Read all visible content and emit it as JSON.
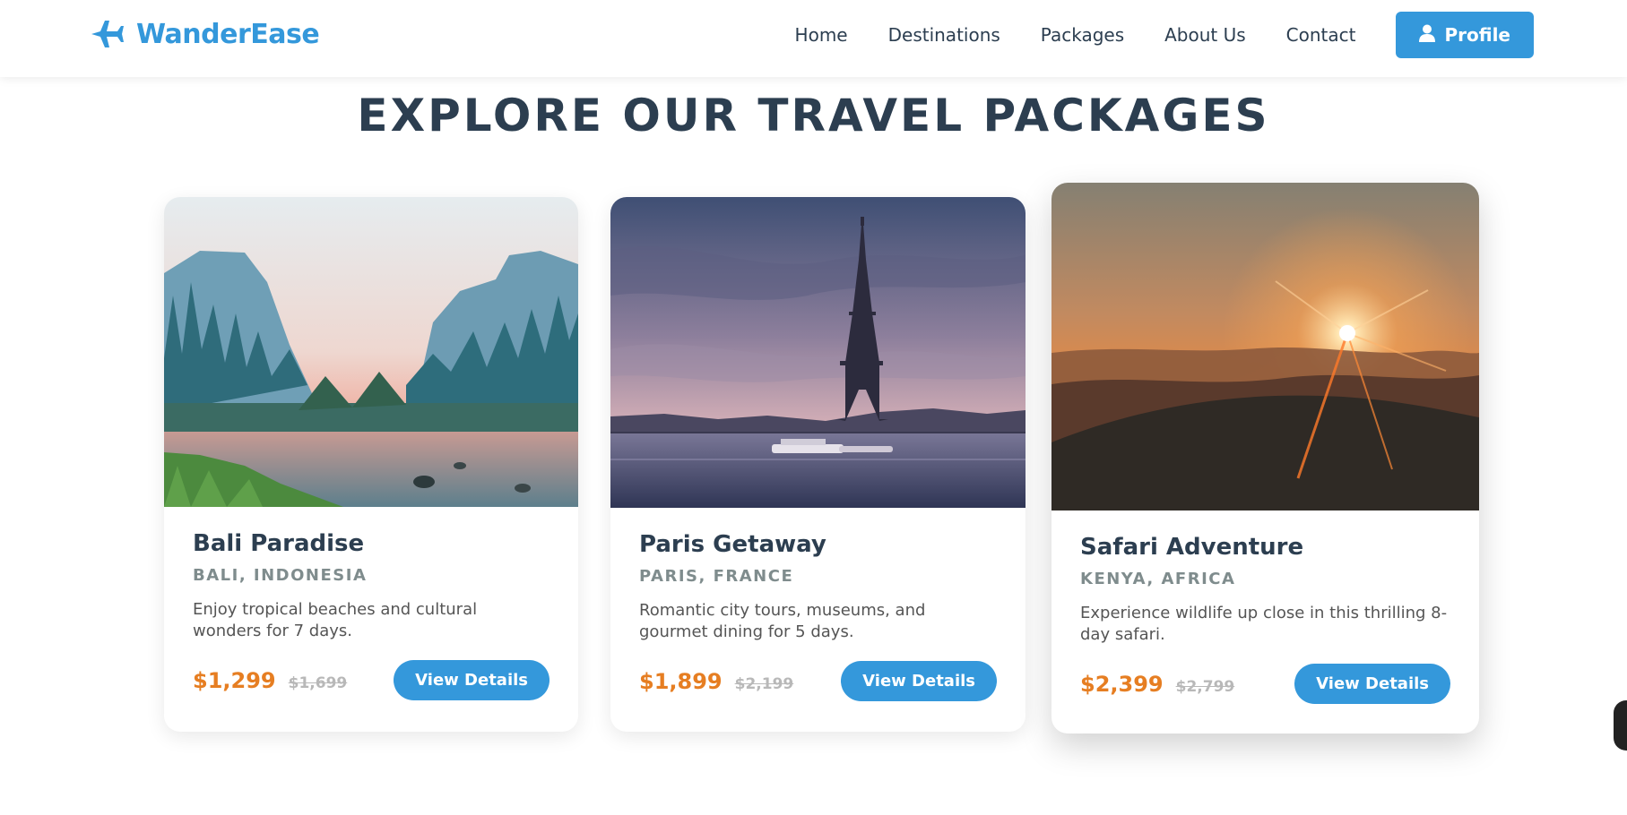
{
  "brand": {
    "name": "WanderEase",
    "icon": "airplane-icon",
    "color": "#3498db"
  },
  "nav": {
    "links": [
      "Home",
      "Destinations",
      "Packages",
      "About Us",
      "Contact"
    ],
    "profile_label": "Profile",
    "profile_icon": "user-icon"
  },
  "page": {
    "title": "EXPLORE OUR TRAVEL PACKAGES"
  },
  "packages": [
    {
      "title": "Bali Paradise",
      "location": "BALI, INDONESIA",
      "description": "Enjoy tropical beaches and cultural wonders for 7 days.",
      "price": "$1,299",
      "old_price": "$1,699",
      "button": "View Details"
    },
    {
      "title": "Paris Getaway",
      "location": "PARIS, FRANCE",
      "description": "Romantic city tours, museums, and gourmet dining for 5 days.",
      "price": "$1,899",
      "old_price": "$2,199",
      "button": "View Details"
    },
    {
      "title": "Safari Adventure",
      "location": "KENYA, AFRICA",
      "description": "Experience wildlife up close in this thrilling 8-day safari.",
      "price": "$2,399",
      "old_price": "$2,799",
      "button": "View Details"
    }
  ],
  "colors": {
    "accent": "#3498db",
    "price": "#e67e22",
    "heading": "#2c3e50",
    "muted": "#7f8c8d"
  }
}
